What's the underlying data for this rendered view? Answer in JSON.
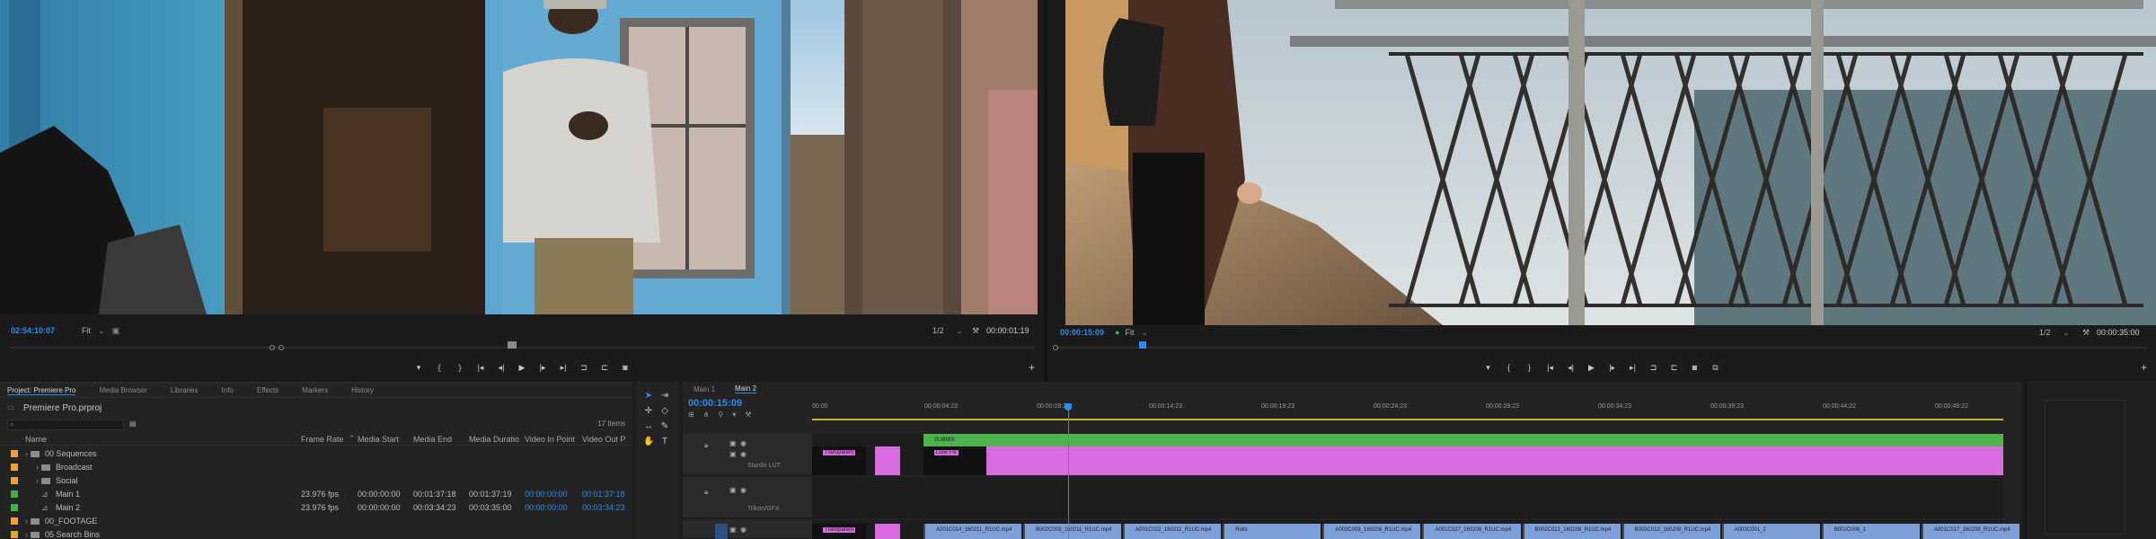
{
  "source_monitor": {
    "timecode": "02:54:10:07",
    "fit": "Fit",
    "resolution": "1/2",
    "duration": "00:00:01:19",
    "transport_icons": [
      "marker-icon",
      "in-point-icon",
      "out-point-icon",
      "go-to-in-icon",
      "step-back-icon",
      "play-icon",
      "step-forward-icon",
      "go-to-out-icon",
      "insert-icon",
      "overwrite-icon",
      "export-frame-icon"
    ]
  },
  "program_monitor": {
    "timecode": "00:00:15:09",
    "fit": "Fit",
    "resolution": "1/2",
    "duration": "00:00:35:00"
  },
  "project_panel": {
    "tabs": [
      "Project: Premiere Pro",
      "Media Browser",
      "Libraries",
      "Info",
      "Effects",
      "Markers",
      "History"
    ],
    "title": "Premiere Pro.prproj",
    "items_count": "17 Items",
    "columns": [
      "Name",
      "Frame Rate",
      "Media Start",
      "Media End",
      "Media Duratio",
      "Video In Point",
      "Video Out P"
    ],
    "rows": [
      {
        "name": "00 Sequences",
        "color": "#e8a23a",
        "kind": "folder",
        "indent": 1
      },
      {
        "name": "Broadcast",
        "color": "#e8a23a",
        "kind": "folder",
        "indent": 2
      },
      {
        "name": "Social",
        "color": "#e8a23a",
        "kind": "folder",
        "indent": 2
      },
      {
        "name": "Main 1",
        "color": "#3fb24f",
        "kind": "sequence",
        "indent": 2,
        "frame_rate": "23.976 fps",
        "media_start": "00:00:00:00",
        "media_end": "00:01:37:18",
        "duration": "00:01:37:19",
        "video_in": "00:00:00:00",
        "video_out": "00:01:37:18"
      },
      {
        "name": "Main 2",
        "color": "#3fb24f",
        "kind": "sequence",
        "indent": 2,
        "frame_rate": "23.976 fps",
        "media_start": "00:00:00:00",
        "media_end": "00:03:34:23",
        "duration": "00:03:35:00",
        "video_in": "00:00:00:00",
        "video_out": "00:03:34:23"
      },
      {
        "name": "00_FOOTAGE",
        "color": "#e8a23a",
        "kind": "folder",
        "indent": 1
      },
      {
        "name": "05 Search Bins",
        "color": "#e8a23a",
        "kind": "folder",
        "indent": 1
      }
    ]
  },
  "timeline": {
    "tabs": [
      "Main 1",
      "Main 2"
    ],
    "active_tab": "Main 2",
    "timecode": "00:00:15:09",
    "ruler_labels": [
      "00:00",
      "00:00:04:23",
      "00:00:09:23",
      "00:00:14:23",
      "00:00:19:23",
      "00:00:24:23",
      "00:00:29:23",
      "00:00:34:23",
      "00:00:39:23",
      "00:00:44:22",
      "00:00:49:22"
    ],
    "tracks": [
      {
        "name": "Stardix LUT",
        "clips": [
          {
            "label": "SUBMIX",
            "color": "#4db34a",
            "row": 0
          },
          {
            "label": "Transparent",
            "color": "#d86be0",
            "row": 1
          },
          {
            "label": "Look Fix",
            "color": "#d86be0",
            "row": 1
          }
        ]
      },
      {
        "name": "Trikon/GFX",
        "clips": [
          {
            "label": "Transparent",
            "color": "#d86be0",
            "row": 0
          }
        ]
      }
    ],
    "video_clips": [
      "A001C014_160211_R1UC.mp4",
      "B002C003_160211_R1UC.mp4",
      "A001C022_160211_R1UC.mp4",
      "Rolls",
      "A003C008_160208_R1UC.mp4",
      "A001C027_160208_R1UC.mp4",
      "B002C021_160208_R1UC.mp4",
      "B003C012_160208_R1UC.mp4",
      "A003C001_1",
      "B002C006_1",
      "A001C017_160208_R1UC.mp4"
    ]
  },
  "colors": {
    "accent": "#2d8ceb",
    "green_clip": "#4db34a",
    "pink_clip": "#d86be0",
    "blue_clip": "#7ea0d8"
  }
}
